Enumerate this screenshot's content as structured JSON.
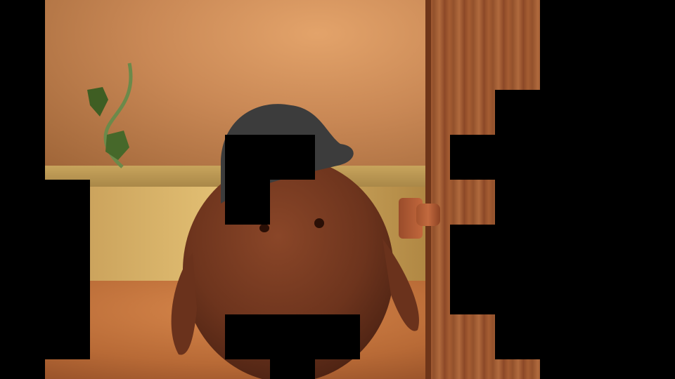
{
  "scene": {
    "wall_color": "#c98855",
    "door_color": "#a55d33",
    "character_color": "#7a3b22",
    "hat_color": "#3c3c3c"
  }
}
